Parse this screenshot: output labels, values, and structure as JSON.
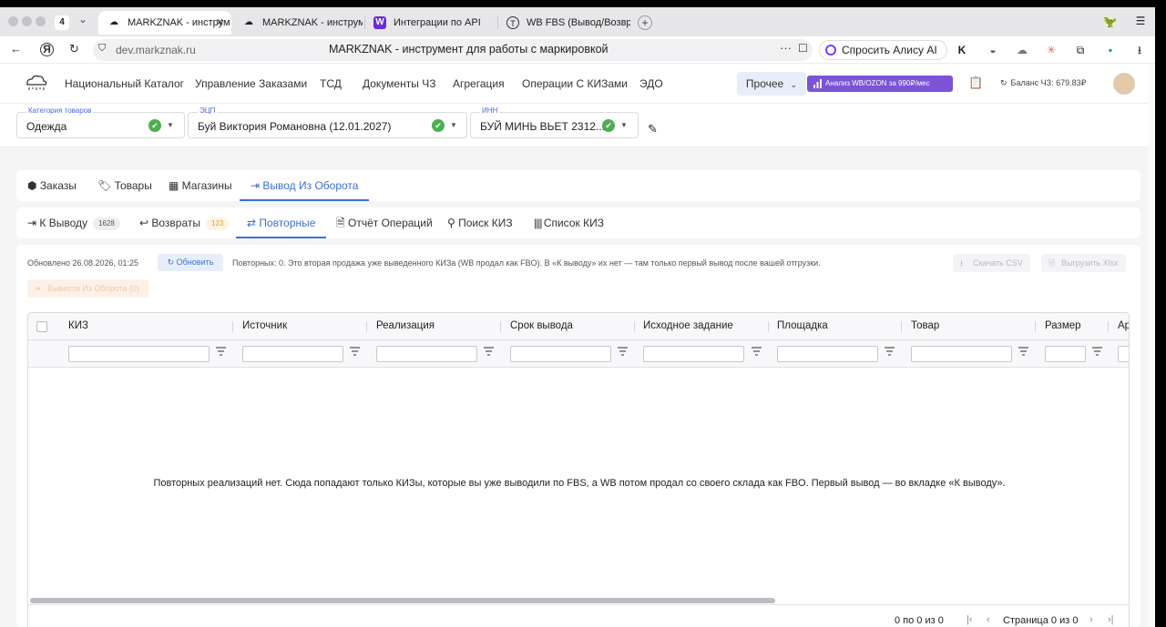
{
  "browser": {
    "tab_count": "4",
    "tabs": [
      {
        "title": "MARKZNAK - инструм"
      },
      {
        "title": "MARKZNAK - инструмент"
      },
      {
        "title": "Интеграции по API"
      },
      {
        "title": "WB FBS (Вывод/Возврат"
      }
    ],
    "url": "dev.markznak.ru",
    "page_title": "MARKZNAK - инструмент для работы с маркировкой",
    "alice_label": "Спросить Алису AI"
  },
  "nav": {
    "items": [
      "Национальный Каталог",
      "Управление Заказами",
      "ТСД",
      "Документы ЧЗ",
      "Агрегация",
      "Операции С КИЗами",
      "ЭДО"
    ],
    "more_label": "Прочее",
    "promo_label": "Анализ WB/OZON за 990₽/мес",
    "balance": "Баланс ЧЗ: 679.83₽"
  },
  "selectors": {
    "category": {
      "label": "Категория товаров",
      "value": "Одежда"
    },
    "ecp": {
      "label": "ЭЦП",
      "value": "Буй Виктория Романовна (12.01.2027)"
    },
    "inn": {
      "label": "ИНН",
      "value": "БУЙ МИНЬ ВЬЕТ 2312..."
    }
  },
  "main_tabs": [
    "Заказы",
    "Товары",
    "Магазины",
    "Вывод Из Оборота"
  ],
  "sub_tabs": [
    {
      "label": "К Выводу",
      "badge": "1628"
    },
    {
      "label": "Возвраты",
      "badge": "123"
    },
    {
      "label": "Повторные"
    },
    {
      "label": "Отчёт Операций"
    },
    {
      "label": "Поиск КИЗ"
    },
    {
      "label": "Список КИЗ"
    }
  ],
  "content": {
    "updated": "Обновлено 26.08.2026, 01:25",
    "refresh_label": "Обновить",
    "info": "Повторных: 0. Это вторая продажа уже выведенного КИЗа (WB продал как FBO). В «К выводу» их нет — там только первый вывод после вашей отгрузки.",
    "download_csv": "Скачать CSV",
    "export_xlsx": "Выгрузить Xlsx",
    "withdraw_label": "Вывести Из Оборота (0)"
  },
  "grid": {
    "columns": [
      "КИЗ",
      "Источник",
      "Реализация",
      "Срок вывода",
      "Исходное задание",
      "Площадка",
      "Товар",
      "Размер",
      "Ар"
    ],
    "empty_message": "Повторных реализаций нет. Сюда попадают только КИЗы, которые вы уже выводили по FBS, а WB потом продал со своего склада как FBO. Первый вывод — во вкладке «К выводу».",
    "rows_info": "0 по 0 из 0",
    "page_info": "Страница 0 из 0"
  }
}
